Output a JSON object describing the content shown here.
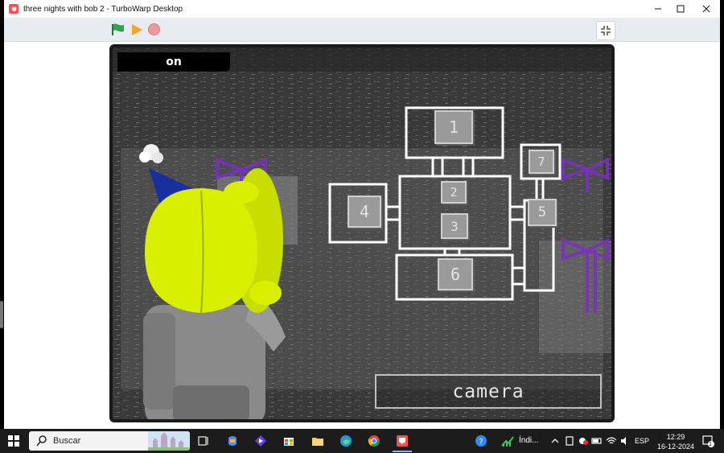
{
  "window": {
    "title": "three nights with bob 2 - TurboWarp Desktop"
  },
  "toolbar": {
    "green_flag": "green-flag",
    "pause": "pause",
    "stop": "stop",
    "fullscreen": "exit-fullscreen"
  },
  "game": {
    "status_label": "on",
    "camera_button_label": "camera",
    "map_rooms": [
      "1",
      "2",
      "3",
      "4",
      "5",
      "6",
      "7"
    ]
  },
  "taskbar": {
    "search_placeholder": "Buscar",
    "tray_app_label": "Índi...",
    "language": "ESP",
    "time": "12:29",
    "date": "16-12-2024",
    "notification_count": "1"
  },
  "colors": {
    "accent_red": "#ff4c4c",
    "flag_green": "#2ca44a",
    "pause_orange": "#f5a623",
    "stop_red": "#ec9b9b",
    "character_yellow": "#d8f000",
    "hat_blue": "#1a2f9e",
    "bow_purple": "#7a2fc4"
  }
}
